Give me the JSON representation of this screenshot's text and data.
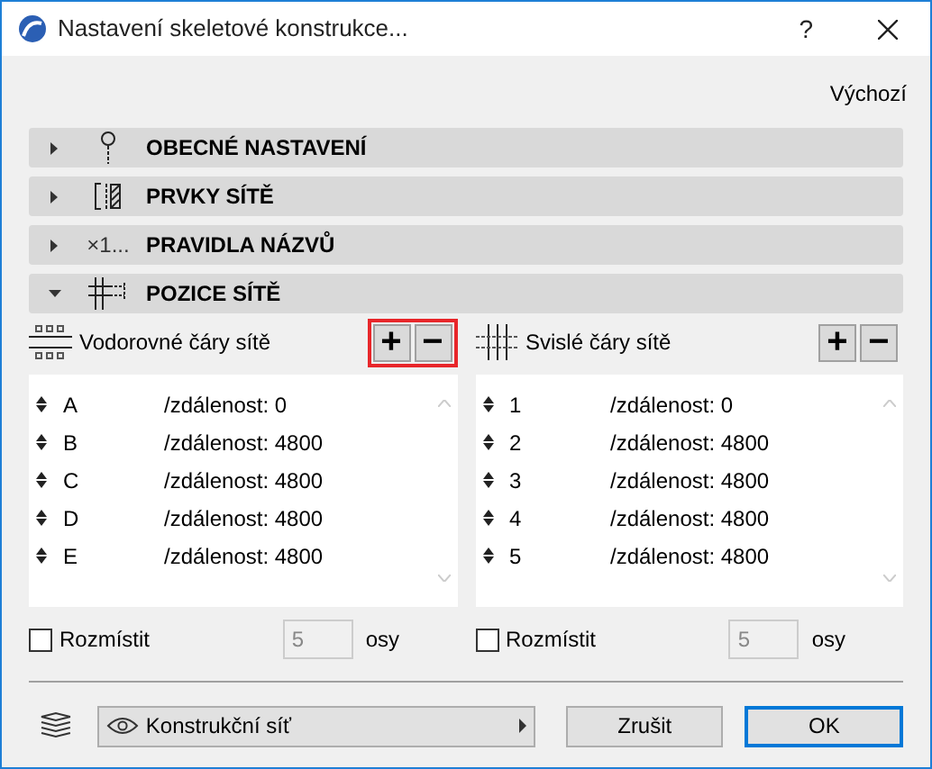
{
  "window": {
    "title": "Nastavení skeletové konstrukce...",
    "help": "?"
  },
  "defaults_link": "Výchozí",
  "sections": [
    {
      "title": "OBECNÉ NASTAVENÍ",
      "expanded": false,
      "kind": "pin"
    },
    {
      "title": "PRVKY SÍTĚ",
      "expanded": false,
      "kind": "panel"
    },
    {
      "title": "PRAVIDLA NÁZVŮ",
      "expanded": false,
      "kind": "label",
      "icon_text": "×1..."
    },
    {
      "title": "POZICE SÍTĚ",
      "expanded": true,
      "kind": "grid"
    }
  ],
  "panels": [
    {
      "title": "Vodorovné čáry sítě",
      "kind": "horizontal",
      "add": "+",
      "remove": "−",
      "highlighted": true,
      "rows": [
        {
          "name": "A",
          "distance": "/zdálenost: 0"
        },
        {
          "name": "B",
          "distance": "/zdálenost: 4800"
        },
        {
          "name": "C",
          "distance": "/zdálenost: 4800"
        },
        {
          "name": "D",
          "distance": "/zdálenost: 4800"
        },
        {
          "name": "E",
          "distance": "/zdálenost: 4800"
        }
      ],
      "distribute": {
        "label": "Rozmístit",
        "checked": false,
        "count": "5",
        "unit": "osy"
      }
    },
    {
      "title": "Svislé čáry sítě",
      "kind": "vertical",
      "add": "+",
      "remove": "−",
      "highlighted": false,
      "rows": [
        {
          "name": "1",
          "distance": "/zdálenost: 0"
        },
        {
          "name": "2",
          "distance": "/zdálenost: 4800"
        },
        {
          "name": "3",
          "distance": "/zdálenost: 4800"
        },
        {
          "name": "4",
          "distance": "/zdálenost: 4800"
        },
        {
          "name": "5",
          "distance": "/zdálenost: 4800"
        }
      ],
      "distribute": {
        "label": "Rozmístit",
        "checked": false,
        "count": "5",
        "unit": "osy"
      }
    }
  ],
  "footer": {
    "layer": "Konstrukční síť",
    "cancel": "Zrušit",
    "ok": "OK"
  }
}
